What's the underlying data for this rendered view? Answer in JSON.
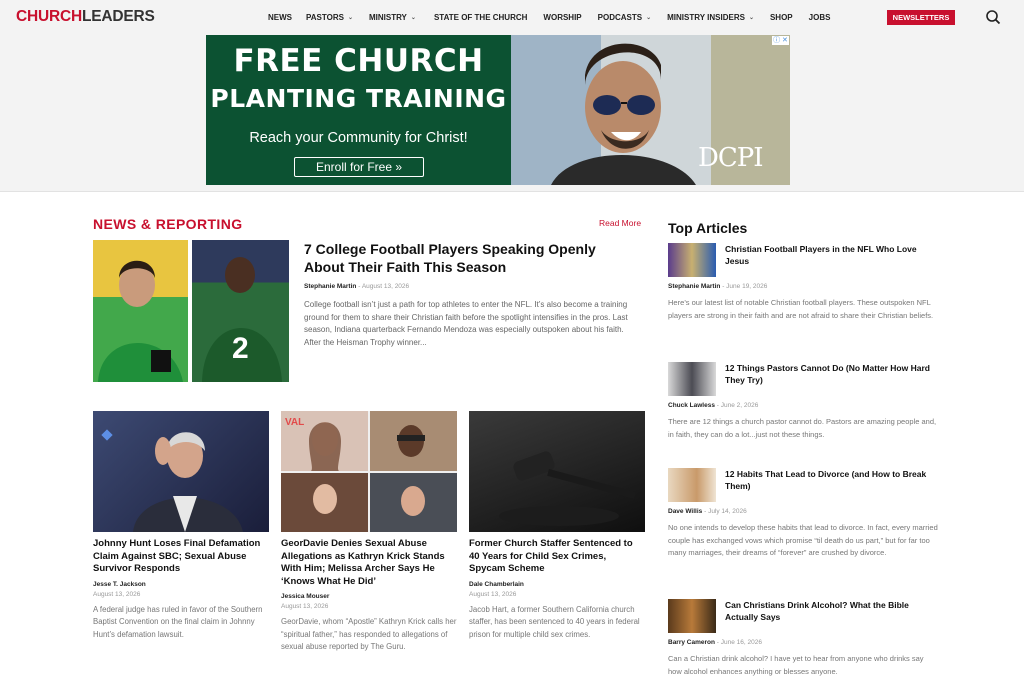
{
  "header": {
    "logo_part1": "CHURCH",
    "logo_part2": "LEADERS",
    "nav": [
      {
        "label": "NEWS",
        "dropdown": false
      },
      {
        "label": "PASTORS",
        "dropdown": true
      },
      {
        "label": "MINISTRY",
        "dropdown": true
      },
      {
        "label": "STATE OF THE CHURCH",
        "dropdown": false
      },
      {
        "label": "WORSHIP",
        "dropdown": false
      },
      {
        "label": "PODCASTS",
        "dropdown": true
      },
      {
        "label": "MINISTRY INSIDERS",
        "dropdown": true
      },
      {
        "label": "SHOP",
        "dropdown": false
      },
      {
        "label": "JOBS",
        "dropdown": false
      }
    ],
    "newsletters": "NEWSLETTERS",
    "search_icon": "search-icon",
    "chevron_icon": "chevron-down-icon"
  },
  "ad": {
    "line1": "FREE CHURCH",
    "line2": "PLANTING TRAINING",
    "sub": "Reach your Community for Christ!",
    "cta": "Enroll for Free",
    "brand": "DCPI"
  },
  "news": {
    "heading": "NEWS & REPORTING",
    "read_more": "Read More",
    "hero": {
      "title": "7 College Football Players Speaking Openly About Their Faith This Season",
      "author": "Stephanie Martin",
      "date": "August 13, 2026",
      "excerpt": "College football isn’t just a path for top athletes to enter the NFL. It’s also become a training ground for them to share their Christian faith before the spotlight intensifies in the pros. Last season, Indiana quarterback Fernando Mendoza was especially outspoken about his faith. After the Heisman Trophy winner..."
    },
    "cards": [
      {
        "title": "Johnny Hunt Loses Final Defamation Claim Against SBC; Sexual Abuse Survivor Responds",
        "author": "Jesse T. Jackson",
        "date": "August 13, 2026",
        "excerpt": "A federal judge has ruled in favor of the Southern Baptist Convention on the final claim in Johnny Hunt’s defamation lawsuit."
      },
      {
        "title": "GeorDavie Denies Sexual Abuse Allegations as Kathryn Krick Stands With Him; Melissa Archer Says He ‘Knows What He Did’",
        "author": "Jessica Mouser",
        "date": "August 13, 2026",
        "excerpt": "GeorDavie, whom “Apostle” Kathryn Krick calls her “spiritual father,” has responded to allegations of sexual abuse reported by The Guru."
      },
      {
        "title": "Former Church Staffer Sentenced to 40 Years for Child Sex Crimes, Spycam Scheme",
        "author": "Dale Chamberlain",
        "date": "August 13, 2026",
        "excerpt": "Jacob Hart, a former Southern California church staffer, has been sentenced to 40 years in federal prison for multiple child sex crimes."
      }
    ]
  },
  "sidebar": {
    "heading": "Top Articles",
    "articles": [
      {
        "title": "Christian Football Players in the NFL Who Love Jesus",
        "author": "Stephanie Martin",
        "date": "June 19, 2026",
        "excerpt": "Here’s our latest list of notable Christian football players. These outspoken NFL players are strong in their faith and are not afraid to share their Christian beliefs."
      },
      {
        "title": "12 Things Pastors Cannot Do (No Matter How Hard They Try)",
        "author": "Chuck Lawless",
        "date": "June 2, 2026",
        "excerpt": "There are 12 things a church pastor cannot do. Pastors are amazing people and, in faith, they can do a lot...just not these things."
      },
      {
        "title": "12 Habits That Lead to Divorce (and How to Break Them)",
        "author": "Dave Willis",
        "date": "July 14, 2026",
        "excerpt": "No one intends to develop these habits that lead to divorce. In fact, every married couple has exchanged vows which promise “til death do us part,” but for far too many marriages, their dreams of “forever” are crushed by divorce."
      },
      {
        "title": "Can Christians Drink Alcohol? What the Bible Actually Says",
        "author": "Barry Cameron",
        "date": "June 16, 2026",
        "excerpt": "Can a Christian drink alcohol? I have yet to hear from anyone who drinks say how alcohol enhances anything or blesses anyone."
      }
    ]
  },
  "colors": {
    "brand": "#c8102e",
    "ad_green": "#0c5232"
  }
}
